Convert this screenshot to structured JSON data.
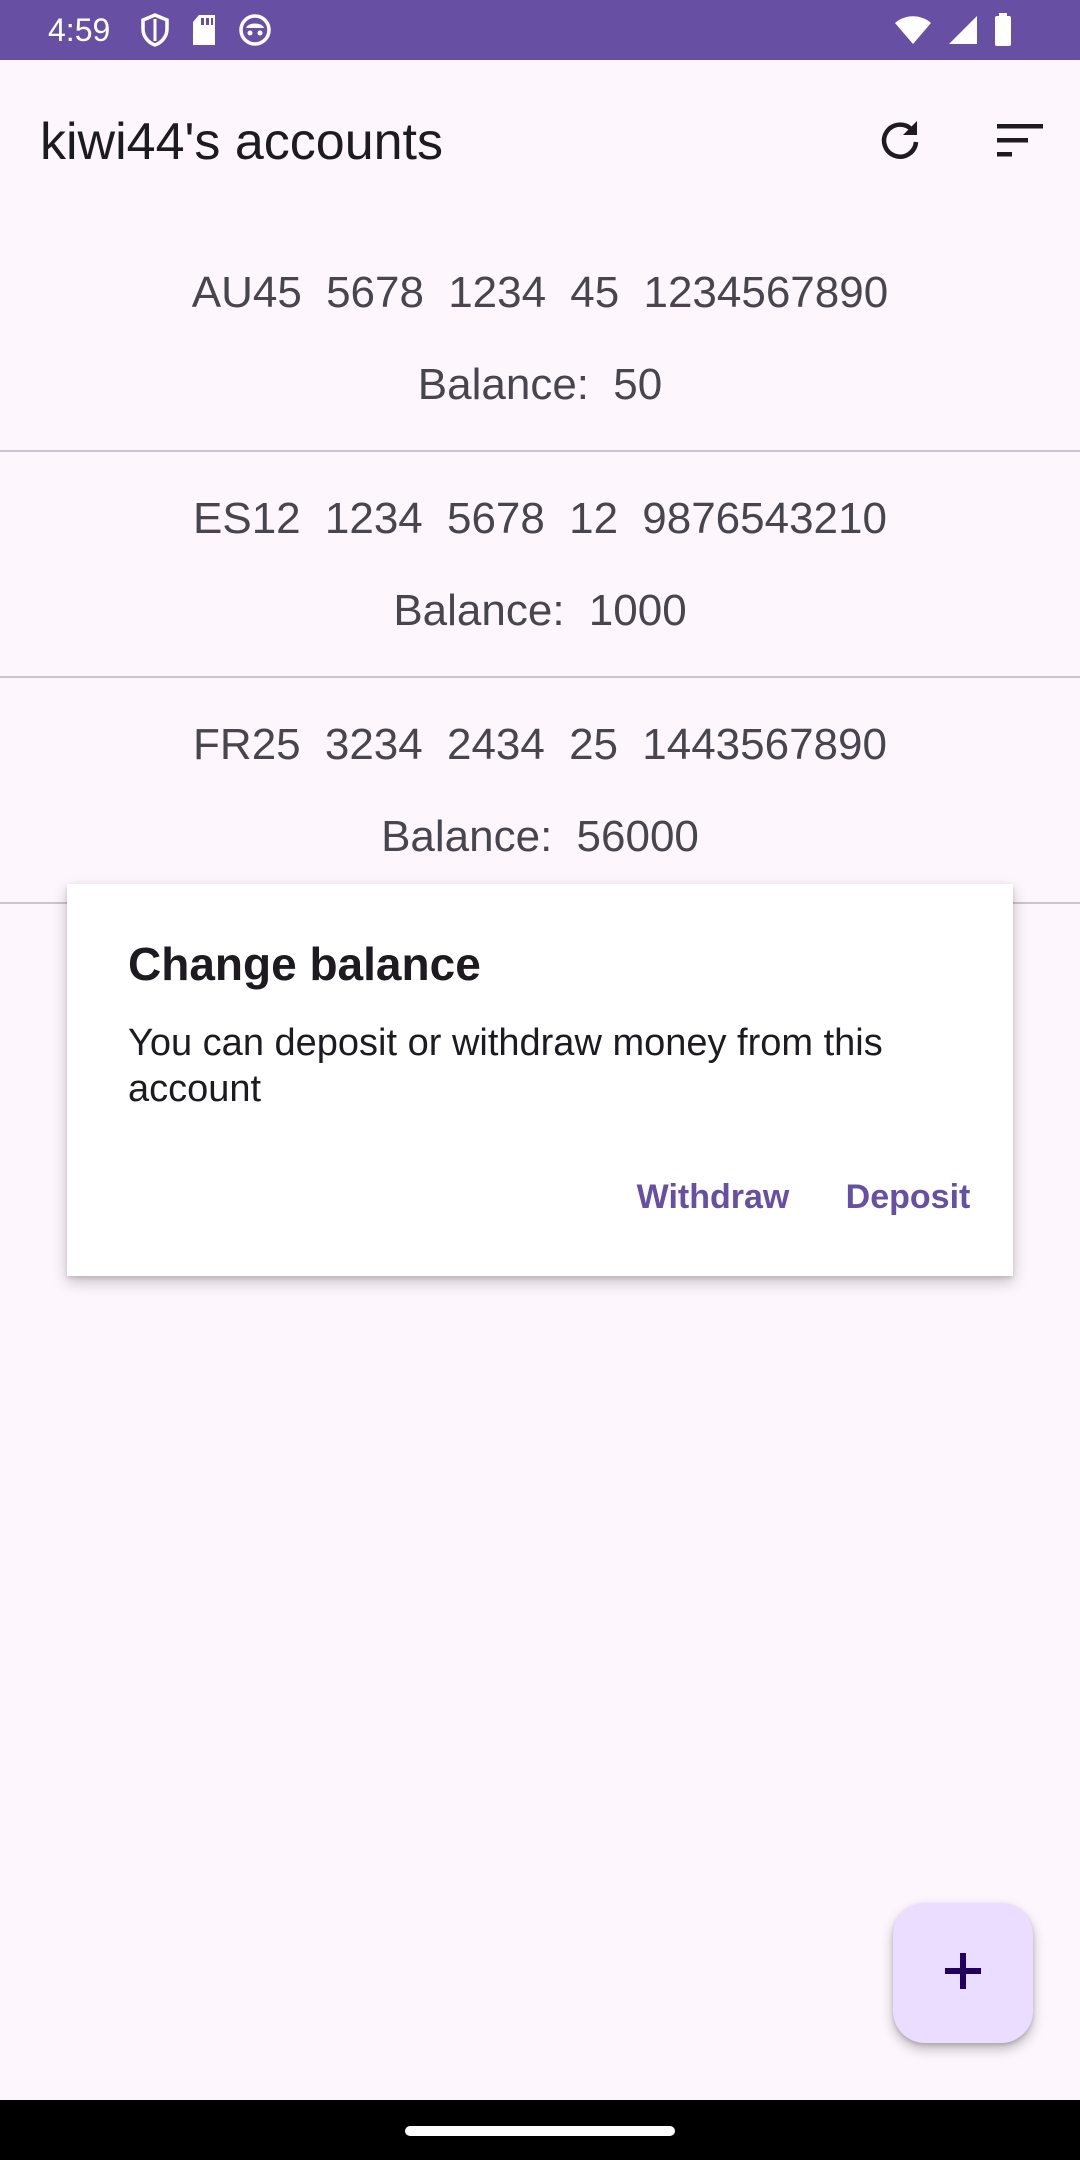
{
  "status_bar": {
    "time": "4:59",
    "color": "#6750a4",
    "left_icons": [
      "shield-icon",
      "sd-card-icon",
      "robot-face-icon"
    ],
    "right_icons": [
      "wifi-icon",
      "signal-icon",
      "battery-icon"
    ]
  },
  "app_bar": {
    "title": "kiwi44's accounts",
    "actions": [
      "refresh-icon",
      "sort-icon"
    ]
  },
  "accounts": [
    {
      "iban": "AU45  5678  1234  45  1234567890",
      "balance_label": "Balance:",
      "balance": "50"
    },
    {
      "iban": "ES12  1234  5678  12  9876543210",
      "balance_label": "Balance:",
      "balance": "1000"
    },
    {
      "iban": "FR25  3234  2434  25  1443567890",
      "balance_label": "Balance:",
      "balance": "56000"
    }
  ],
  "dialog": {
    "title": "Change balance",
    "message": "You can deposit or withdraw money from this account",
    "withdraw_label": "Withdraw",
    "deposit_label": "Deposit"
  },
  "fab": {
    "icon": "plus-icon",
    "color": "#eaddff"
  },
  "colors": {
    "primary": "#6750a4",
    "background": "#fdf7fd",
    "dialog_button": "#6750a4"
  }
}
